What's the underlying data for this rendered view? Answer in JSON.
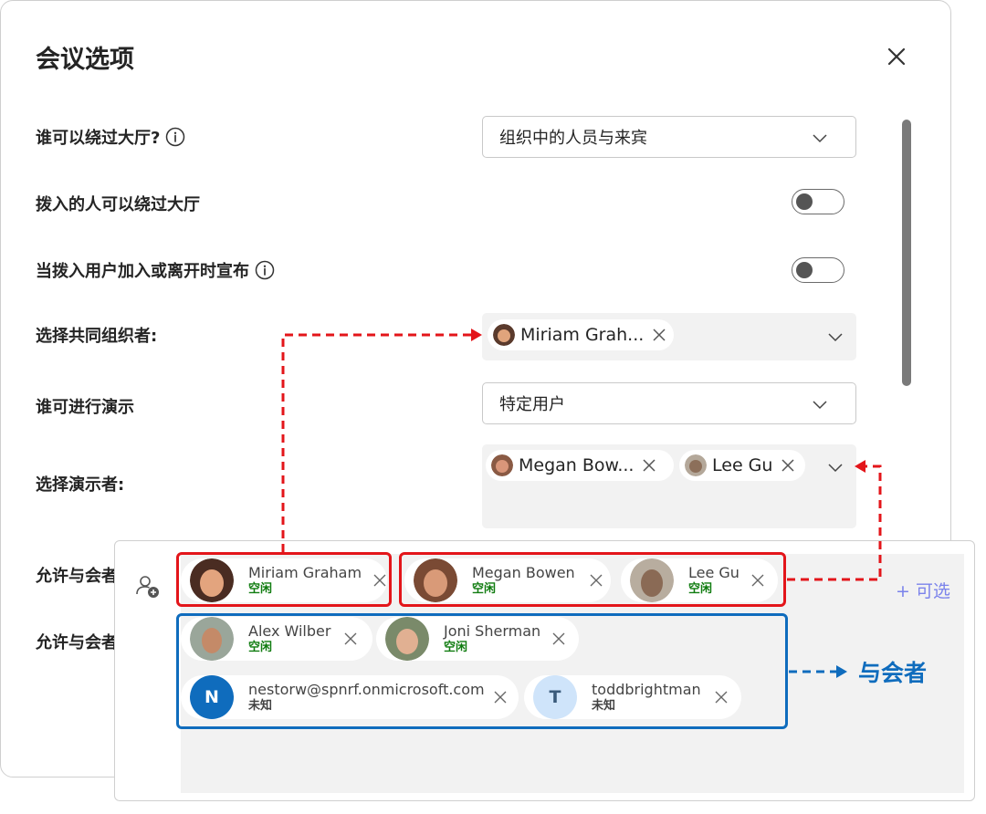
{
  "dialog": {
    "title": "会议选项",
    "close_icon": "close-icon"
  },
  "options": {
    "bypass_lobby": {
      "label": "谁可以绕过大厅?",
      "value": "组织中的人员与来宾"
    },
    "dialin_bypass": {
      "label": "拨入的人可以绕过大厅",
      "enabled": false
    },
    "announce_dialin": {
      "label": "当拨入用户加入或离开时宣布",
      "enabled": false
    },
    "co_organizers": {
      "label": "选择共同组织者:",
      "chips": [
        "Miriam Grah..."
      ]
    },
    "who_presents": {
      "label": "谁可进行演示",
      "value": "特定用户"
    },
    "presenters": {
      "label": "选择演示者:",
      "chips": [
        "Megan Bow...",
        "Lee Gu"
      ]
    },
    "allow_1": {
      "label": "允许与会者"
    },
    "allow_2": {
      "label": "允许与会者"
    }
  },
  "attendee_panel": {
    "optional_link": "+ 可选",
    "organizers": [
      {
        "name": "Miriam Graham",
        "status": "空闲",
        "status_color": "#107c10"
      }
    ],
    "presenters": [
      {
        "name": "Megan Bowen",
        "status": "空闲",
        "status_color": "#107c10"
      },
      {
        "name": "Lee Gu",
        "status": "空闲",
        "status_color": "#107c10"
      }
    ],
    "attendees": [
      {
        "name": "Alex Wilber",
        "status": "空闲",
        "status_color": "#107c10"
      },
      {
        "name": "Joni Sherman",
        "status": "空闲",
        "status_color": "#107c10"
      },
      {
        "name": "nestorw@spnrf.onmicrosoft.com",
        "status": "未知",
        "status_color": "#424242",
        "initial": "N",
        "avatar_color": "#0f6cbd"
      },
      {
        "name": "toddbrightman",
        "status": "未知",
        "status_color": "#424242",
        "initial": "T",
        "avatar_color": "#cfe4fa"
      }
    ]
  },
  "annotation": {
    "attendee_callout": "与会者"
  },
  "colors": {
    "red_highlight": "#e3151a",
    "blue_highlight": "#0f6cbd",
    "link": "#7b83eb",
    "available": "#107c10"
  }
}
